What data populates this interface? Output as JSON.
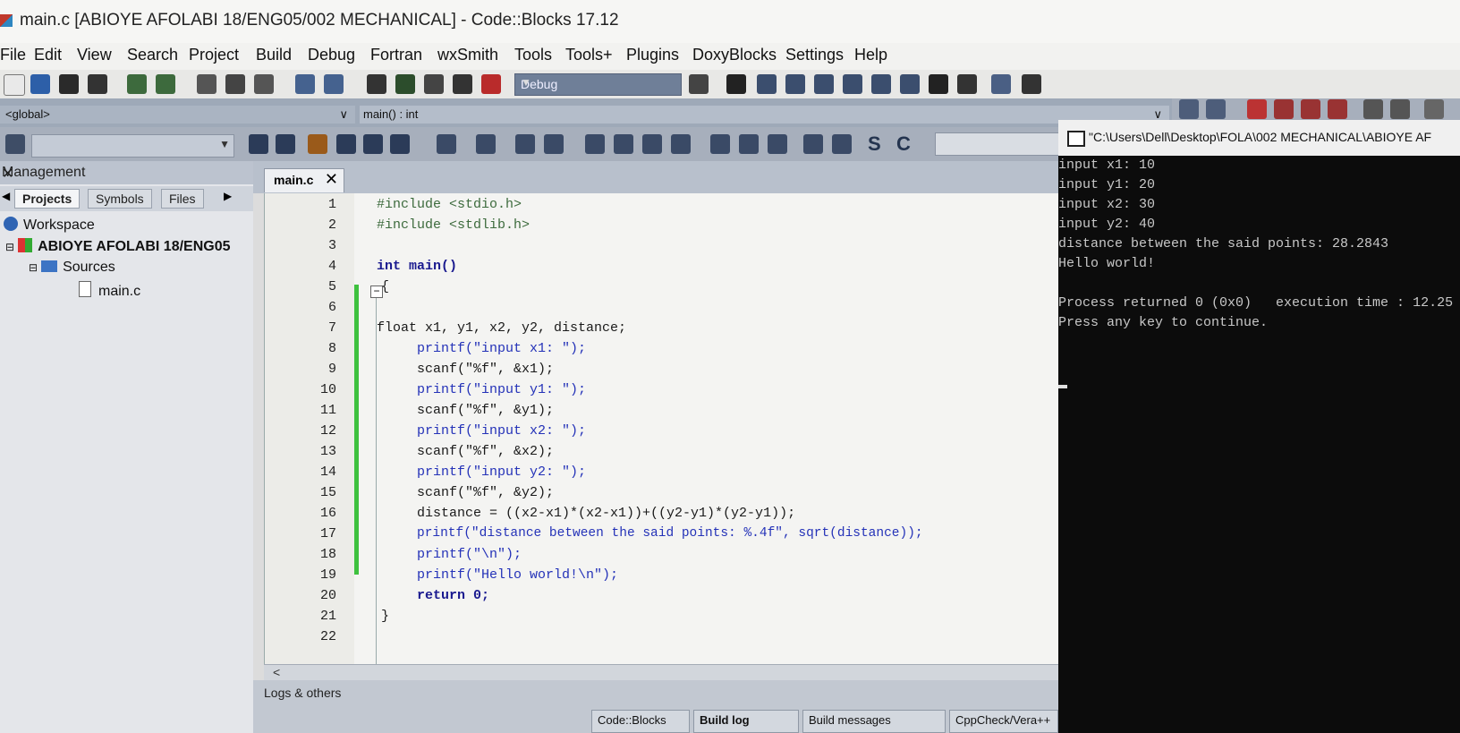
{
  "window": {
    "title": "main.c [ABIOYE AFOLABI 18/ENG05/002 MECHANICAL] - Code::Blocks 17.12"
  },
  "menu": [
    "File",
    "Edit",
    "View",
    "Search",
    "Project",
    "Build",
    "Debug",
    "Fortran",
    "wxSmith",
    "Tools",
    "Tools+",
    "Plugins",
    "DoxyBlocks",
    "Settings",
    "Help"
  ],
  "toolbar": {
    "build_target": "Debug",
    "scope_global": "<global>",
    "scope_function": "main() : int"
  },
  "management": {
    "title": "Management",
    "tabs": [
      "Projects",
      "Symbols",
      "Files"
    ],
    "tree": {
      "workspace": "Workspace",
      "project": "ABIOYE AFOLABI 18/ENG05",
      "sources": "Sources",
      "file": "main.c"
    }
  },
  "editor": {
    "tab": "main.c",
    "lines": [
      {
        "n": "1",
        "text": "#include <stdio.h>"
      },
      {
        "n": "2",
        "text": "#include <stdlib.h>"
      },
      {
        "n": "3",
        "text": ""
      },
      {
        "n": "4",
        "text": "int main()"
      },
      {
        "n": "5",
        "text": "{"
      },
      {
        "n": "6",
        "text": ""
      },
      {
        "n": "7",
        "text": "float x1, y1, x2, y2, distance;"
      },
      {
        "n": "8",
        "text": "printf(\"input x1: \");"
      },
      {
        "n": "9",
        "text": "scanf(\"%f\", &x1);"
      },
      {
        "n": "10",
        "text": "printf(\"input y1: \");"
      },
      {
        "n": "11",
        "text": "scanf(\"%f\", &y1);"
      },
      {
        "n": "12",
        "text": "printf(\"input x2: \");"
      },
      {
        "n": "13",
        "text": "scanf(\"%f\", &x2);"
      },
      {
        "n": "14",
        "text": "printf(\"input y2: \");"
      },
      {
        "n": "15",
        "text": "scanf(\"%f\", &y2);"
      },
      {
        "n": "16",
        "text": "distance = ((x2-x1)*(x2-x1))+((y2-y1)*(y2-y1));"
      },
      {
        "n": "17",
        "text": "printf(\"distance between the said points: %.4f\", sqrt(distance));"
      },
      {
        "n": "18",
        "text": "printf(\"\\n\");"
      },
      {
        "n": "19",
        "text": "printf(\"Hello world!\\n\");"
      },
      {
        "n": "20",
        "text": "return 0;"
      },
      {
        "n": "21",
        "text": "}"
      },
      {
        "n": "22",
        "text": ""
      }
    ]
  },
  "logs": {
    "label": "Logs & others",
    "tabs": [
      "Code::Blocks",
      "Build log",
      "Build messages",
      "CppCheck/Vera++"
    ]
  },
  "console": {
    "title": "\"C:\\Users\\Dell\\Desktop\\FOLA\\002 MECHANICAL\\ABIOYE AF",
    "lines": [
      "input x1: 10",
      "input y1: 20",
      "input x2: 30",
      "input y2: 40",
      "distance between the said points: 28.2843",
      "Hello world!",
      "",
      "Process returned 0 (0x0)   execution time : 12.25",
      "Press any key to continue."
    ]
  }
}
